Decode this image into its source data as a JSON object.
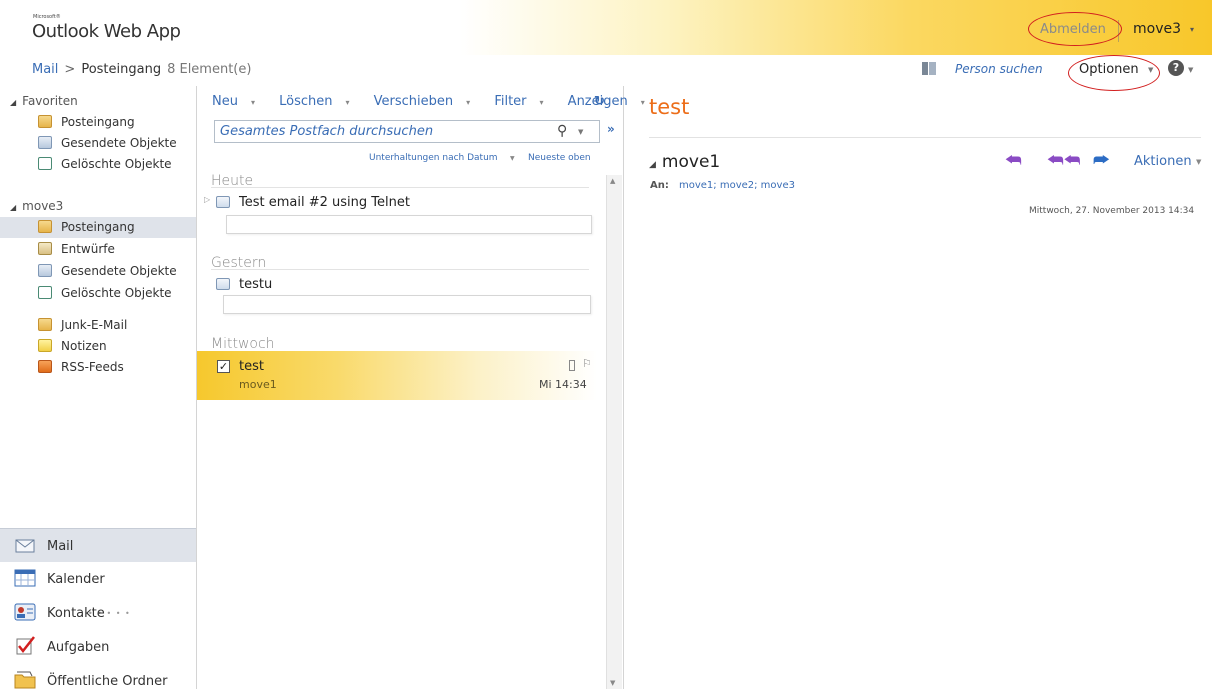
{
  "header": {
    "brand_small": "Microsoft®",
    "brand": "Outlook Web App",
    "signout": "Abmelden",
    "user": "move3",
    "user_caret": "▾"
  },
  "breadcrumb": {
    "root": "Mail",
    "separator": ">",
    "folder": "Posteingang",
    "count": "8 Element(e)"
  },
  "top_actions": {
    "person_search": "Person suchen",
    "options": "Optionen",
    "help": "?"
  },
  "nav": {
    "favorites_label": "Favoriten",
    "favorites": [
      {
        "label": "Posteingang",
        "icon": "inbox-folder-icon"
      },
      {
        "label": "Gesendete Objekte",
        "icon": "sent-folder-icon"
      },
      {
        "label": "Gelöschte Objekte",
        "icon": "deleted-folder-icon"
      }
    ],
    "mailbox_label": "move3",
    "mailbox": [
      {
        "label": "Posteingang",
        "icon": "inbox-folder-icon",
        "selected": true
      },
      {
        "label": "Entwürfe",
        "icon": "drafts-folder-icon"
      },
      {
        "label": "Gesendete Objekte",
        "icon": "sent-folder-icon"
      },
      {
        "label": "Gelöschte Objekte",
        "icon": "deleted-folder-icon"
      },
      {
        "label": "Junk-E-Mail",
        "icon": "junk-folder-icon"
      },
      {
        "label": "Notizen",
        "icon": "notes-folder-icon"
      },
      {
        "label": "RSS-Feeds",
        "icon": "rss-folder-icon"
      }
    ],
    "modules": [
      {
        "label": "Mail",
        "icon": "mail-icon",
        "selected": true
      },
      {
        "label": "Kalender",
        "icon": "calendar-icon"
      },
      {
        "label": "Kontakte",
        "icon": "contacts-icon"
      },
      {
        "label": "Aufgaben",
        "icon": "tasks-icon"
      },
      {
        "label": "Öffentliche Ordner",
        "icon": "public-folders-icon"
      }
    ]
  },
  "list": {
    "toolbar": [
      "Neu",
      "Löschen",
      "Verschieben",
      "Filter",
      "Anzeigen"
    ],
    "search_placeholder": "Gesamtes Postfach durchsuchen",
    "sort_label": "Unterhaltungen nach Datum",
    "sort_order": "Neueste oben",
    "groups": [
      {
        "label": "Heute",
        "messages": [
          {
            "subject": "Test email #2 using Telnet"
          }
        ]
      },
      {
        "label": "Gestern",
        "messages": [
          {
            "subject": "testu"
          }
        ]
      },
      {
        "label": "Mittwoch",
        "messages": [
          {
            "subject": "test",
            "from": "move1",
            "time": "Mi 14:34",
            "selected": true
          }
        ]
      }
    ]
  },
  "reading": {
    "subject": "test",
    "sender": "move1",
    "to_label": "An:",
    "to": "move1; move2; move3",
    "date": "Mittwoch, 27. November 2013 14:34",
    "actions": "Aktionen"
  },
  "colors": {
    "accent_orange": "#ec6d19",
    "link_blue": "#3a6db5",
    "highlight_yellow": "#f6c82d",
    "annotation_red": "#d21f1f"
  }
}
